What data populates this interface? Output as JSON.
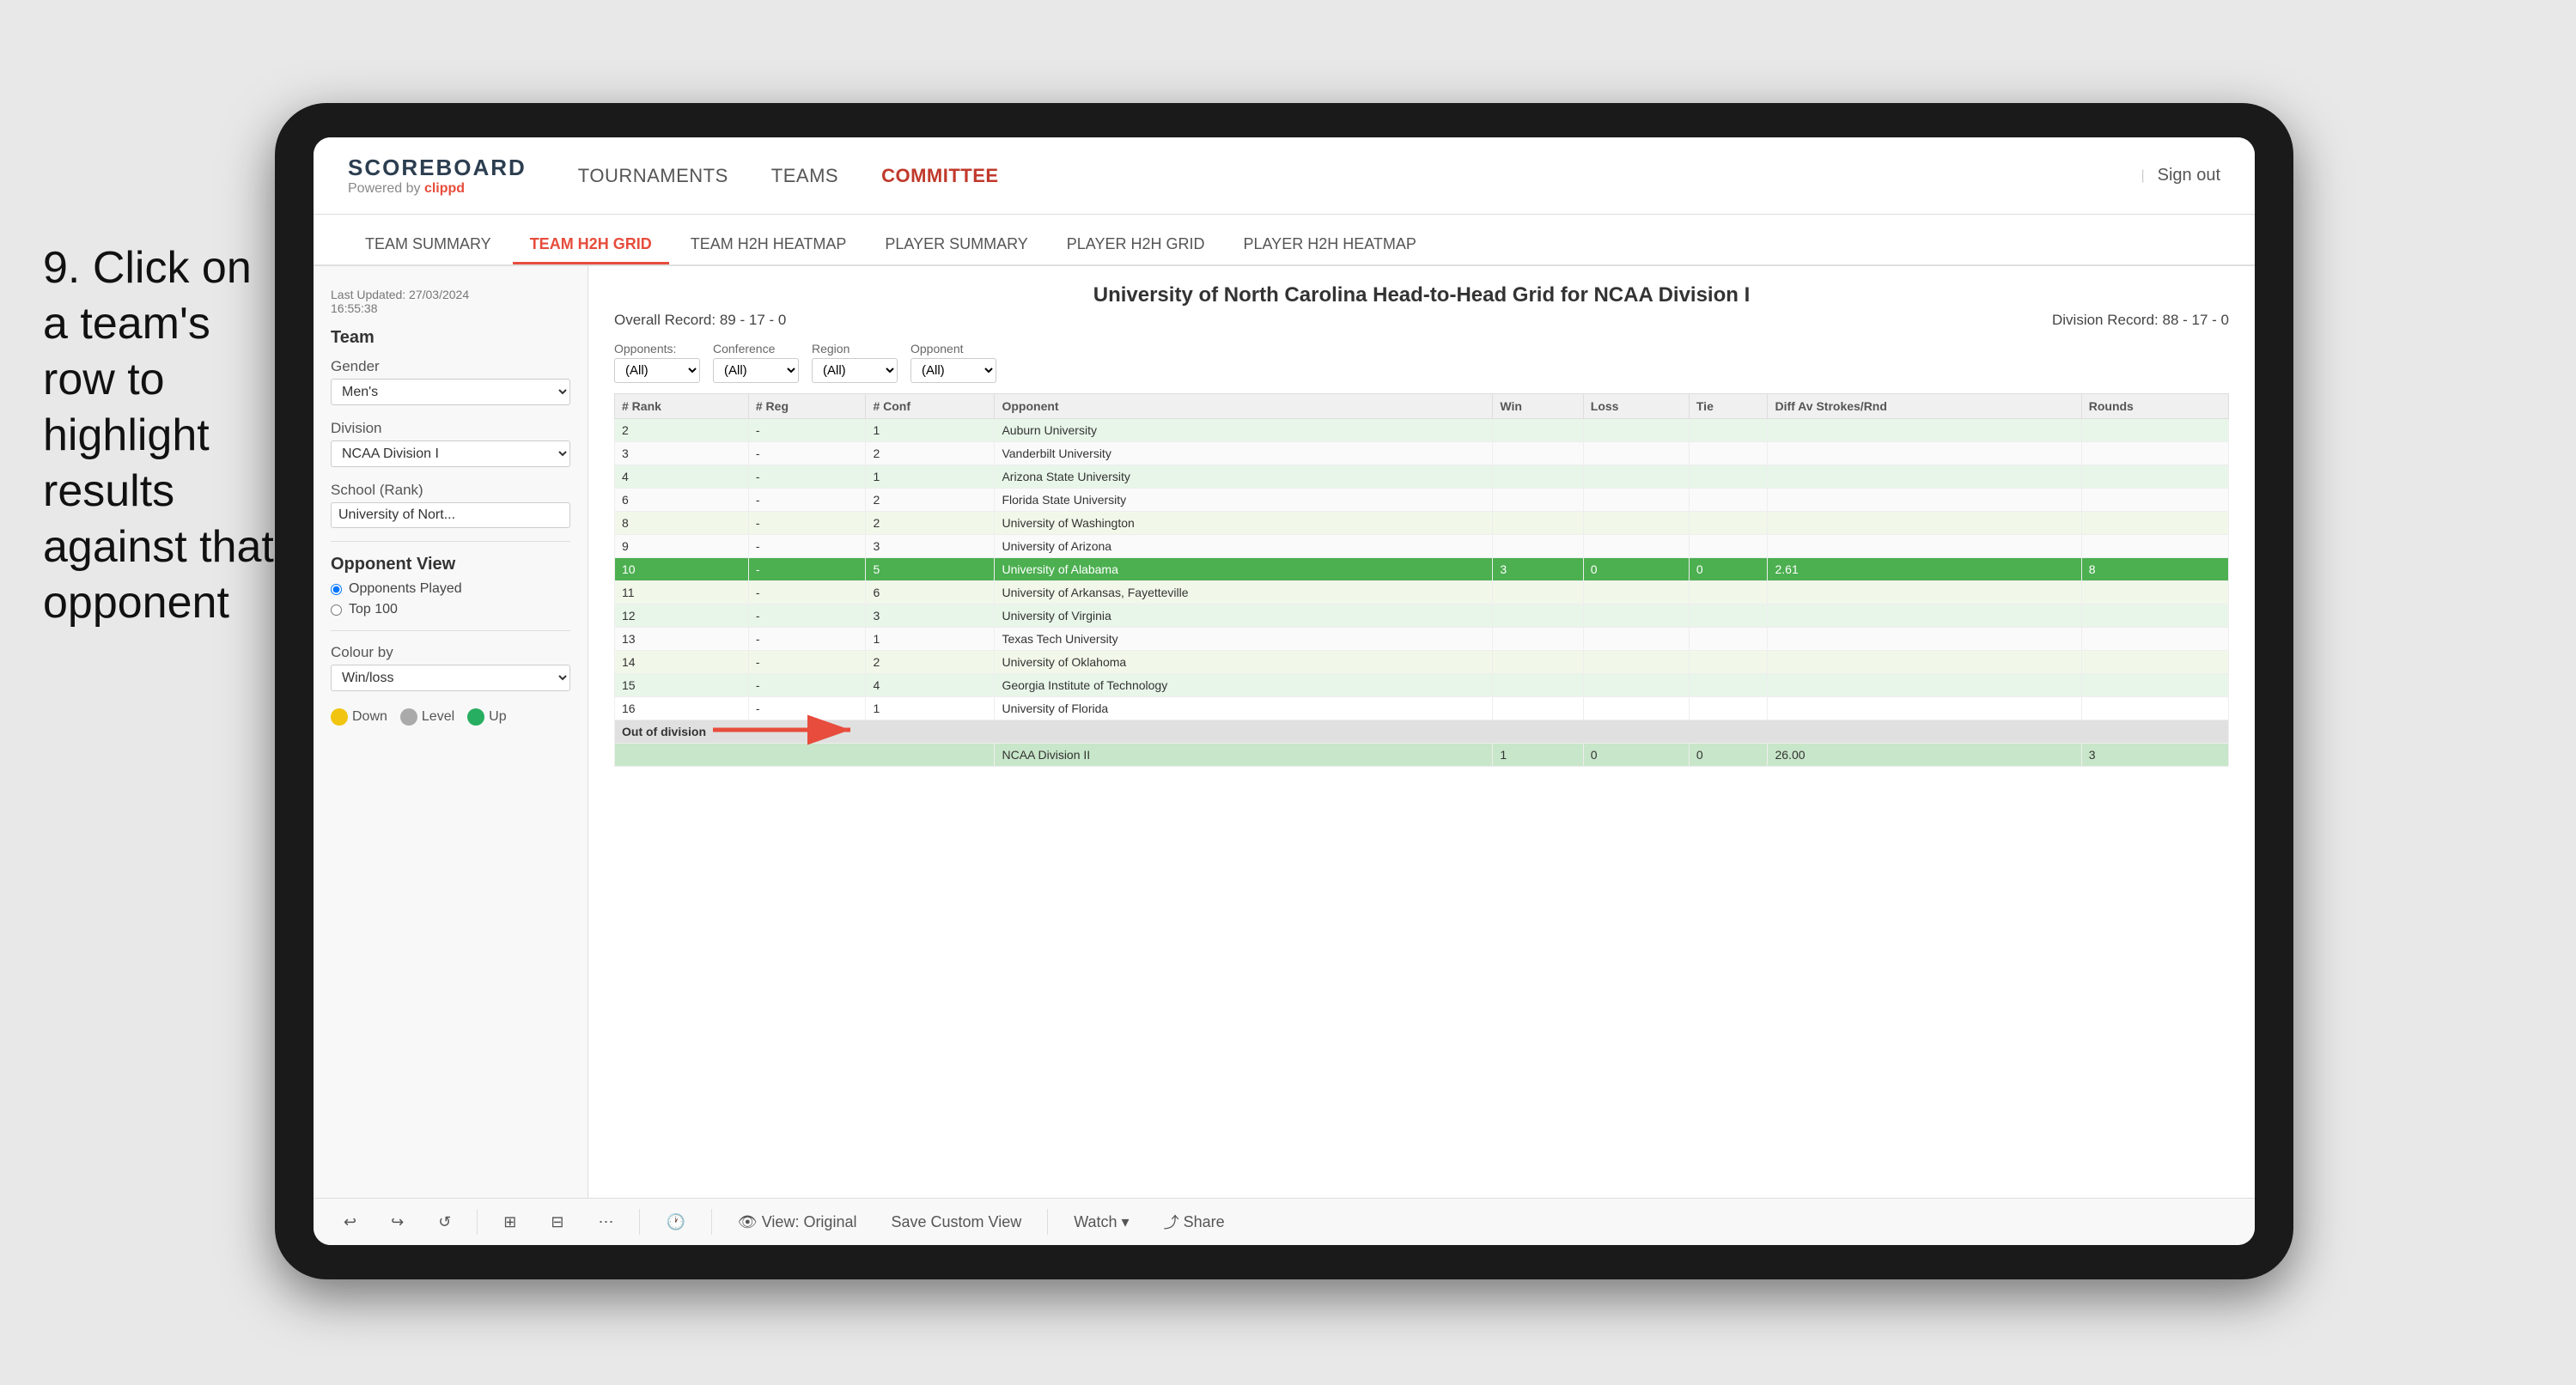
{
  "instruction": {
    "text": "9. Click on a team's row to highlight results against that opponent"
  },
  "nav": {
    "logo": "SCOREBOARD",
    "logo_sub": "Powered by clippd",
    "items": [
      "TOURNAMENTS",
      "TEAMS",
      "COMMITTEE"
    ],
    "active_item": "COMMITTEE",
    "sign_out": "Sign out"
  },
  "sub_nav": {
    "items": [
      "TEAM SUMMARY",
      "TEAM H2H GRID",
      "TEAM H2H HEATMAP",
      "PLAYER SUMMARY",
      "PLAYER H2H GRID",
      "PLAYER H2H HEATMAP"
    ],
    "active_item": "TEAM H2H GRID"
  },
  "sidebar": {
    "last_updated_label": "Last Updated: 27/03/2024",
    "last_updated_time": "16:55:38",
    "team_label": "Team",
    "gender_label": "Gender",
    "gender_value": "Men's",
    "division_label": "Division",
    "division_value": "NCAA Division I",
    "school_label": "School (Rank)",
    "school_value": "University of Nort...",
    "opponent_view_label": "Opponent View",
    "radio_opponents": "Opponents Played",
    "radio_top100": "Top 100",
    "colour_by_label": "Colour by",
    "colour_by_value": "Win/loss",
    "legend_down": "Down",
    "legend_level": "Level",
    "legend_up": "Up"
  },
  "h2h": {
    "title": "University of North Carolina Head-to-Head Grid for NCAA Division I",
    "overall_record_label": "Overall Record:",
    "overall_record": "89 - 17 - 0",
    "division_record_label": "Division Record:",
    "division_record": "88 - 17 - 0",
    "filters": {
      "opponents_label": "Opponents:",
      "opponents_value": "(All)",
      "conference_label": "Conference",
      "conference_value": "(All)",
      "region_label": "Region",
      "region_value": "(All)",
      "opponent_label": "Opponent",
      "opponent_value": "(All)"
    },
    "table_headers": [
      "# Rank",
      "# Reg",
      "# Conf",
      "Opponent",
      "Win",
      "Loss",
      "Tie",
      "Diff Av Strokes/Rnd",
      "Rounds"
    ],
    "rows": [
      {
        "rank": "2",
        "reg": "-",
        "conf": "1",
        "opponent": "Auburn University",
        "win": "",
        "loss": "",
        "tie": "",
        "diff": "",
        "rounds": "",
        "highlight": false,
        "style": "light"
      },
      {
        "rank": "3",
        "reg": "-",
        "conf": "2",
        "opponent": "Vanderbilt University",
        "win": "",
        "loss": "",
        "tie": "",
        "diff": "",
        "rounds": "",
        "highlight": false,
        "style": "lighter"
      },
      {
        "rank": "4",
        "reg": "-",
        "conf": "1",
        "opponent": "Arizona State University",
        "win": "",
        "loss": "",
        "tie": "",
        "diff": "",
        "rounds": "",
        "highlight": false,
        "style": "light"
      },
      {
        "rank": "6",
        "reg": "-",
        "conf": "2",
        "opponent": "Florida State University",
        "win": "",
        "loss": "",
        "tie": "",
        "diff": "",
        "rounds": "",
        "highlight": false,
        "style": ""
      },
      {
        "rank": "8",
        "reg": "-",
        "conf": "2",
        "opponent": "University of Washington",
        "win": "",
        "loss": "",
        "tie": "",
        "diff": "",
        "rounds": "",
        "highlight": false,
        "style": "lighter"
      },
      {
        "rank": "9",
        "reg": "-",
        "conf": "3",
        "opponent": "University of Arizona",
        "win": "",
        "loss": "",
        "tie": "",
        "diff": "",
        "rounds": "",
        "highlight": false,
        "style": "light"
      },
      {
        "rank": "10",
        "reg": "-",
        "conf": "5",
        "opponent": "University of Alabama",
        "win": "3",
        "loss": "0",
        "tie": "0",
        "diff": "2.61",
        "rounds": "8",
        "highlight": true,
        "style": "highlighted"
      },
      {
        "rank": "11",
        "reg": "-",
        "conf": "6",
        "opponent": "University of Arkansas, Fayetteville",
        "win": "",
        "loss": "",
        "tie": "",
        "diff": "",
        "rounds": "",
        "highlight": false,
        "style": "lighter"
      },
      {
        "rank": "12",
        "reg": "-",
        "conf": "3",
        "opponent": "University of Virginia",
        "win": "",
        "loss": "",
        "tie": "",
        "diff": "",
        "rounds": "",
        "highlight": false,
        "style": "light"
      },
      {
        "rank": "13",
        "reg": "-",
        "conf": "1",
        "opponent": "Texas Tech University",
        "win": "",
        "loss": "",
        "tie": "",
        "diff": "",
        "rounds": "",
        "highlight": false,
        "style": "lighter"
      },
      {
        "rank": "14",
        "reg": "-",
        "conf": "2",
        "opponent": "University of Oklahoma",
        "win": "",
        "loss": "",
        "tie": "",
        "diff": "",
        "rounds": "",
        "highlight": false,
        "style": ""
      },
      {
        "rank": "15",
        "reg": "-",
        "conf": "4",
        "opponent": "Georgia Institute of Technology",
        "win": "",
        "loss": "",
        "tie": "",
        "diff": "",
        "rounds": "",
        "highlight": false,
        "style": "light"
      },
      {
        "rank": "16",
        "reg": "-",
        "conf": "1",
        "opponent": "University of Florida",
        "win": "",
        "loss": "",
        "tie": "",
        "diff": "",
        "rounds": "",
        "highlight": false,
        "style": "lighter"
      }
    ],
    "out_of_division_label": "Out of division",
    "out_of_division_row": {
      "label": "NCAA Division II",
      "win": "1",
      "loss": "0",
      "tie": "0",
      "diff": "26.00",
      "rounds": "3"
    }
  },
  "toolbar": {
    "undo": "↩",
    "redo": "↪",
    "history": "↺",
    "copy": "⊞",
    "paste": "⊟",
    "refresh": "🕐",
    "view_label": "View: Original",
    "save_custom": "Save Custom View",
    "watch_label": "Watch ▾",
    "share_label": "Share"
  }
}
